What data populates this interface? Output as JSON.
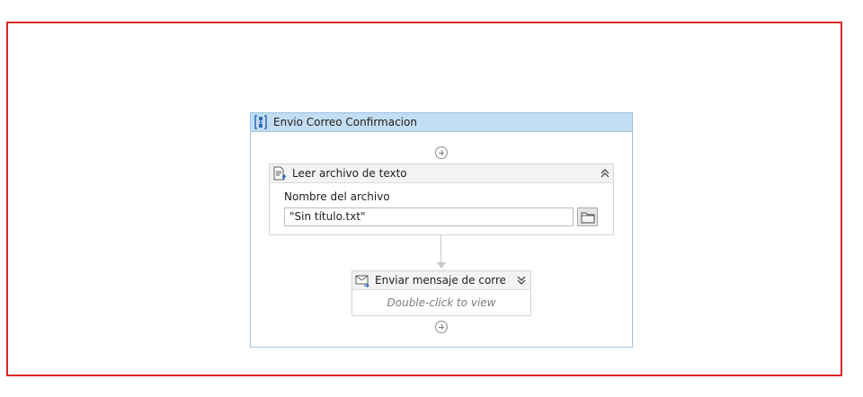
{
  "sequence": {
    "title": "Envio Correo Confirmacion",
    "icon": "sequence-icon"
  },
  "read_activity": {
    "title": "Leer archivo de texto",
    "icon": "read-text-file-icon",
    "field_label": "Nombre del archivo",
    "field_value": "\"Sin título.txt\"",
    "collapse_icon": "double-chevron-up-icon",
    "browse_icon": "folder-icon"
  },
  "mail_activity": {
    "title": "Enviar mensaje de correo d",
    "icon": "send-mail-icon",
    "expand_icon": "double-chevron-down-icon",
    "hint": "Double-click to view"
  },
  "colors": {
    "frame_border": "#d9262b",
    "sequence_header": "#c3ddf2",
    "sequence_border": "#9cc3e2",
    "icon_blue": "#2d6db5"
  }
}
